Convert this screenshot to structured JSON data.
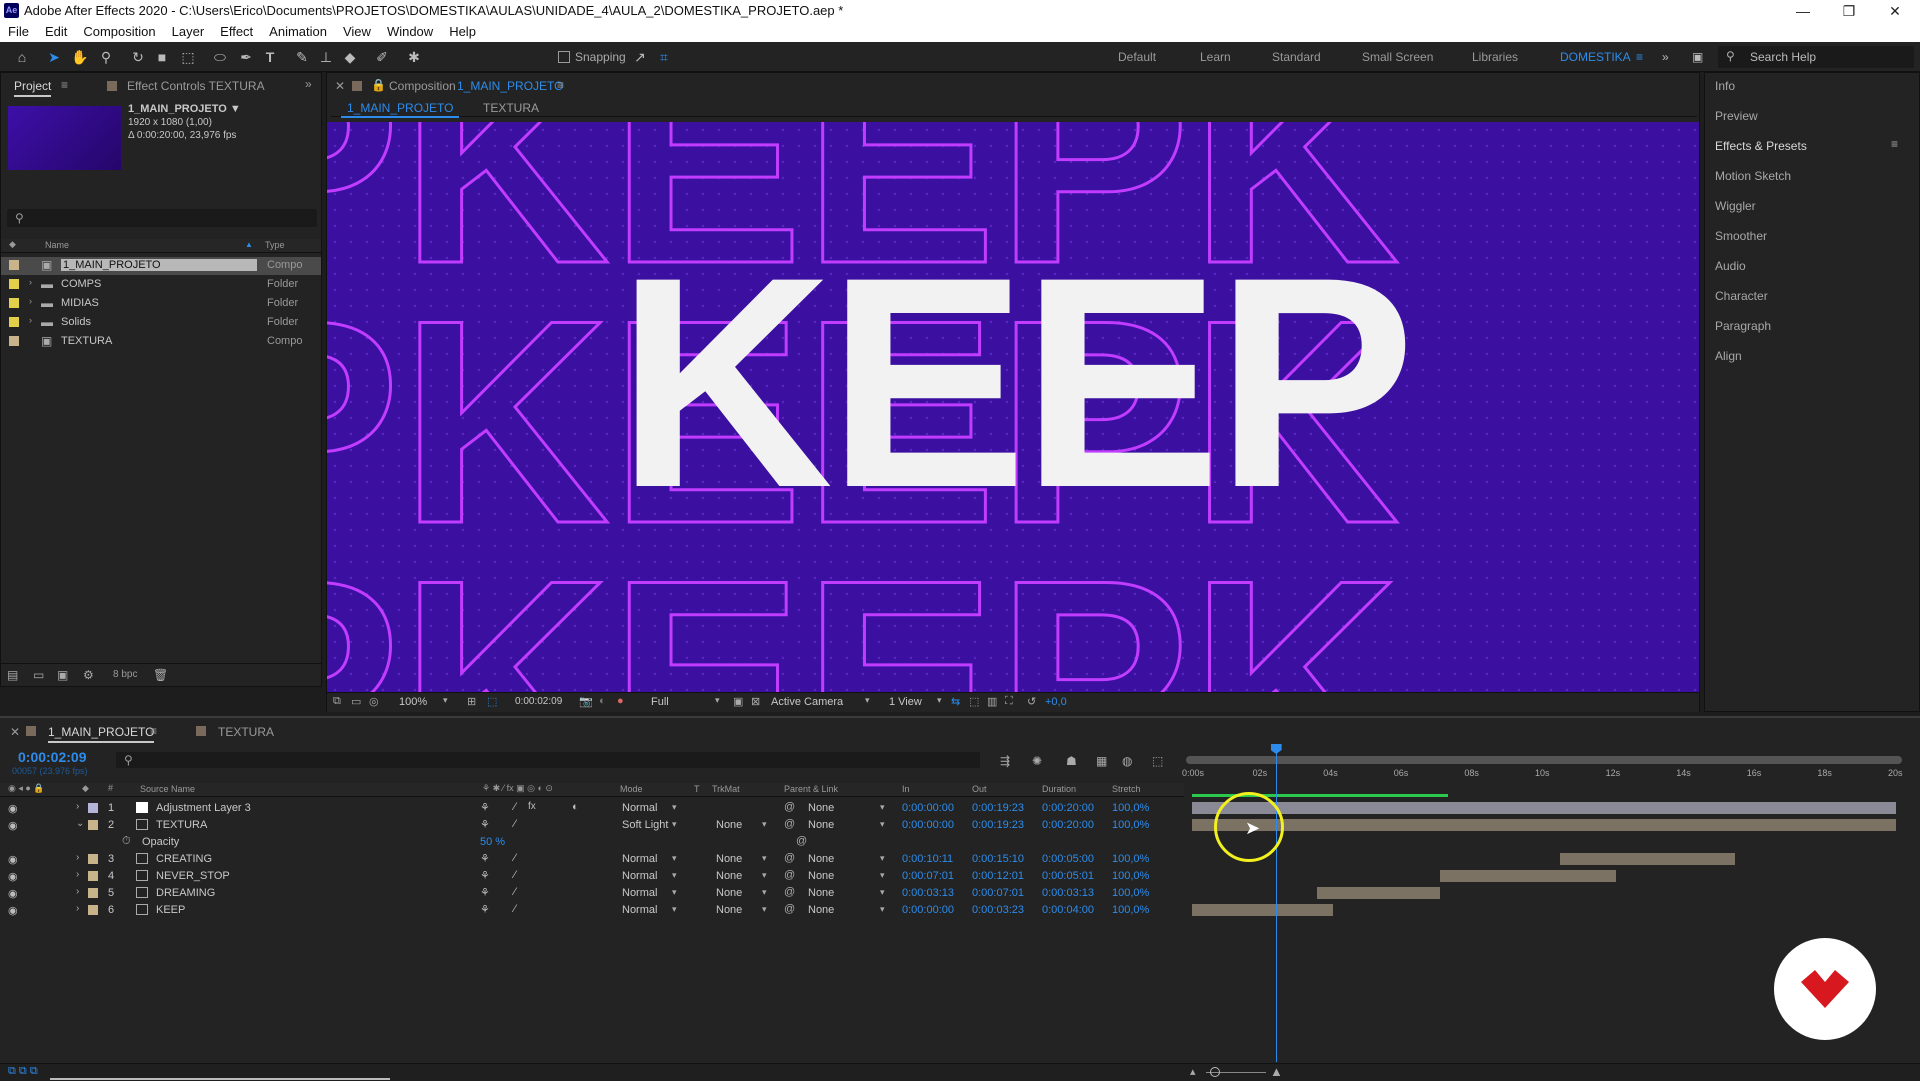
{
  "window": {
    "title": "Adobe After Effects 2020 - C:\\Users\\Erico\\Documents\\PROJETOS\\DOMESTIKA\\AULAS\\UNIDADE_4\\AULA_2\\DOMESTIKA_PROJETO.aep *",
    "app_icon": "Ae",
    "minimize": "—",
    "maximize": "❐",
    "close": "✕"
  },
  "menu": [
    "File",
    "Edit",
    "Composition",
    "Layer",
    "Effect",
    "Animation",
    "View",
    "Window",
    "Help"
  ],
  "toolbar": {
    "snapping": "Snapping",
    "workspaces": [
      "Default",
      "Learn",
      "Standard",
      "Small Screen",
      "Libraries",
      "DOMESTIKA"
    ],
    "search_placeholder": "Search Help"
  },
  "project": {
    "tab": "Project",
    "effect_controls": "Effect Controls TEXTURA",
    "selected_name": "1_MAIN_PROJETO ▼",
    "selected_dims": "1920 x 1080 (1,00)",
    "selected_duration": "Δ 0:00:20:00, 23,976 fps",
    "col_name": "Name",
    "col_type": "Type",
    "bpc": "8 bpc",
    "items": [
      {
        "name": "1_MAIN_PROJETO",
        "type": "Compo",
        "color": "#c9b38a",
        "kind": "comp"
      },
      {
        "name": "COMPS",
        "type": "Folder",
        "color": "#e3d04a",
        "kind": "folder"
      },
      {
        "name": "MIDIAS",
        "type": "Folder",
        "color": "#e3d04a",
        "kind": "folder"
      },
      {
        "name": "Solids",
        "type": "Folder",
        "color": "#e3d04a",
        "kind": "folder"
      },
      {
        "name": "TEXTURA",
        "type": "Compo",
        "color": "#c9b38a",
        "kind": "comp"
      }
    ]
  },
  "comp": {
    "header_prefix": "Composition",
    "header_name": "1_MAIN_PROJETO",
    "tabs": [
      "1_MAIN_PROJETO",
      "TEXTURA"
    ],
    "main_word": "KEEP",
    "bg_word": "PKEEPK",
    "zoom": "100%",
    "time": "0:00:02:09",
    "resolution": "Full",
    "camera": "Active Camera",
    "views": "1 View",
    "exposure": "+0,0"
  },
  "right_panels": [
    "Info",
    "Preview",
    "Effects & Presets",
    "Motion Sketch",
    "Wiggler",
    "Smoother",
    "Audio",
    "Character",
    "Paragraph",
    "Align"
  ],
  "timeline": {
    "tabs": [
      "1_MAIN_PROJETO",
      "TEXTURA"
    ],
    "timecode": "0:00:02:09",
    "frames": "00057 (23.976 fps)",
    "cols": {
      "source": "Source Name",
      "mode": "Mode",
      "t": "T",
      "trkmat": "TrkMat",
      "parent": "Parent & Link",
      "in": "In",
      "out": "Out",
      "dur": "Duration",
      "stretch": "Stretch"
    },
    "ruler": [
      "0:00s",
      "02s",
      "04s",
      "06s",
      "08s",
      "10s",
      "12s",
      "14s",
      "16s",
      "18s",
      "20s"
    ],
    "opacity_label": "Opacity",
    "opacity_value": "50 %",
    "layers": [
      {
        "num": "1",
        "name": "Adjustment Layer 3",
        "mode": "Normal",
        "trkmat": "",
        "parent": "None",
        "in": "0:00:00:00",
        "out": "0:00:19:23",
        "dur": "0:00:20:00",
        "stretch": "100,0%",
        "color": "#b4b4d8",
        "icon": "solid",
        "start": 0,
        "end": 20
      },
      {
        "num": "2",
        "name": "TEXTURA",
        "mode": "Soft Light",
        "trkmat": "None",
        "parent": "None",
        "in": "0:00:00:00",
        "out": "0:00:19:23",
        "dur": "0:00:20:00",
        "stretch": "100,0%",
        "color": "#c9b38a",
        "icon": "comp",
        "start": 0,
        "end": 20
      },
      {
        "num": "3",
        "name": "CREATING",
        "mode": "Normal",
        "trkmat": "None",
        "parent": "None",
        "in": "0:00:10:11",
        "out": "0:00:15:10",
        "dur": "0:00:05:00",
        "stretch": "100,0%",
        "color": "#c9b38a",
        "icon": "comp",
        "start": 10.46,
        "end": 15.42
      },
      {
        "num": "4",
        "name": "NEVER_STOP",
        "mode": "Normal",
        "trkmat": "None",
        "parent": "None",
        "in": "0:00:07:01",
        "out": "0:00:12:01",
        "dur": "0:00:05:01",
        "stretch": "100,0%",
        "color": "#c9b38a",
        "icon": "comp",
        "start": 7.04,
        "end": 12.04
      },
      {
        "num": "5",
        "name": "DREAMING",
        "mode": "Normal",
        "trkmat": "None",
        "parent": "None",
        "in": "0:00:03:13",
        "out": "0:00:07:01",
        "dur": "0:00:03:13",
        "stretch": "100,0%",
        "color": "#c9b38a",
        "icon": "comp",
        "start": 3.54,
        "end": 7.04
      },
      {
        "num": "6",
        "name": "KEEP",
        "mode": "Normal",
        "trkmat": "None",
        "parent": "None",
        "in": "0:00:00:00",
        "out": "0:00:03:23",
        "dur": "0:00:04:00",
        "stretch": "100,0%",
        "color": "#c9b38a",
        "icon": "comp",
        "start": 0,
        "end": 4
      }
    ]
  },
  "colors": {
    "accent": "#2d8ceb",
    "comp_bg": "#3b0fa0",
    "outline": "#c13cff",
    "cursor_ring": "#f2f01e",
    "logo_red": "#d7191f"
  }
}
